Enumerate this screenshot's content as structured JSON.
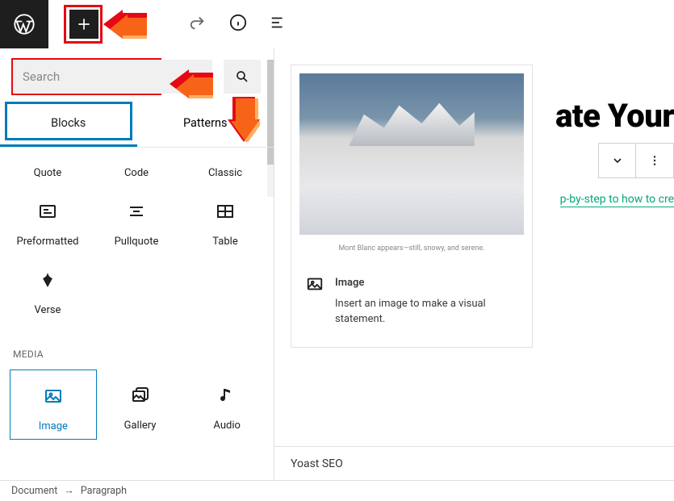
{
  "topbar": {
    "add_tooltip": "Toggle block inserter"
  },
  "inserter": {
    "search_placeholder": "Search",
    "tabs": {
      "blocks": "Blocks",
      "patterns": "Patterns"
    },
    "text_blocks": {
      "quote": "Quote",
      "code": "Code",
      "classic": "Classic",
      "preformatted": "Preformatted",
      "pullquote": "Pullquote",
      "table": "Table",
      "verse": "Verse"
    },
    "media_label": "MEDIA",
    "media_blocks": {
      "image": "Image",
      "gallery": "Gallery",
      "audio": "Audio"
    }
  },
  "preview": {
    "caption": "Mont Blanc appears—still, snowy, and serene.",
    "title": "Image",
    "desc": "Insert an image to make a visual statement."
  },
  "canvas": {
    "heading_fragment": "ate Your",
    "subtext_fragment": "p-by-step to how to cre"
  },
  "footer_panel": "Yoast SEO",
  "breadcrumb": {
    "root": "Document",
    "current": "Paragraph",
    "sep": "→"
  }
}
